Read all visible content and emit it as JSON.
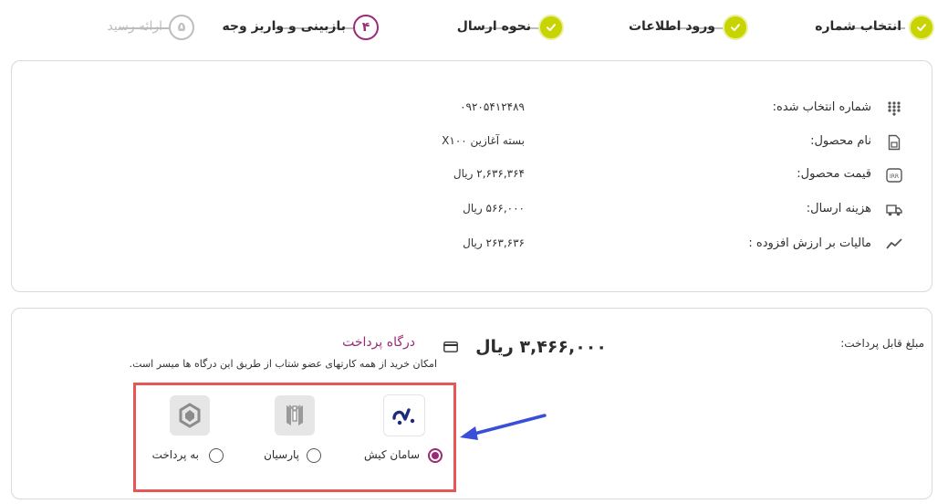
{
  "stepper": {
    "steps": [
      {
        "number": "",
        "label": "انتخاب شماره",
        "state": "done"
      },
      {
        "number": "",
        "label": "ورود اطلاعات",
        "state": "done"
      },
      {
        "number": "",
        "label": "نحوه ارسال",
        "state": "done"
      },
      {
        "number": "۴",
        "label": "بازبینی و واریز وجه",
        "state": "active"
      },
      {
        "number": "۵",
        "label": "ارائه رسید",
        "state": "todo"
      }
    ]
  },
  "summary": {
    "rows": [
      {
        "icon": "dialpad-icon",
        "label": "شماره انتخاب شده:",
        "value": "۰۹۲۰۵۴۱۲۴۸۹"
      },
      {
        "icon": "sim-card-icon",
        "label": "نام محصول:",
        "value": "بسته آغازین X۱۰۰"
      },
      {
        "icon": "price-tag-icon",
        "label": "قیمت محصول:",
        "value": "۲,۶۳۶,۳۶۴ ریال"
      },
      {
        "icon": "delivery-truck-icon",
        "label": "هزینه ارسال:",
        "value": "۵۶۶,۰۰۰ ریال"
      },
      {
        "icon": "trend-chart-icon",
        "label": "مالیات بر ارزش افزوده :",
        "value": "۲۶۳,۶۳۶ ریال"
      }
    ]
  },
  "payment": {
    "amount_label": "مبلغ قابل پرداخت:",
    "amount_value": "۳,۴۶۶,۰۰۰ ریال",
    "gateway_title": "درگاه پرداخت",
    "gateway_desc": "امکان خرید از همه کارتهای عضو شتاب از طریق این درگاه ها میسر است.",
    "banks": [
      {
        "name": "سامان کیش",
        "icon": "saman-kish-logo-icon",
        "selected": true
      },
      {
        "name": "پارسیان",
        "icon": "parsian-logo-icon",
        "selected": false
      },
      {
        "name": "به پرداخت",
        "icon": "behpardakht-logo-icon",
        "selected": false
      }
    ]
  },
  "colors": {
    "done": "#c8d400",
    "active": "#9b2a74",
    "pending": "#bdbdbd",
    "highlight": "#e85555",
    "arrow": "#3a4fd9"
  }
}
